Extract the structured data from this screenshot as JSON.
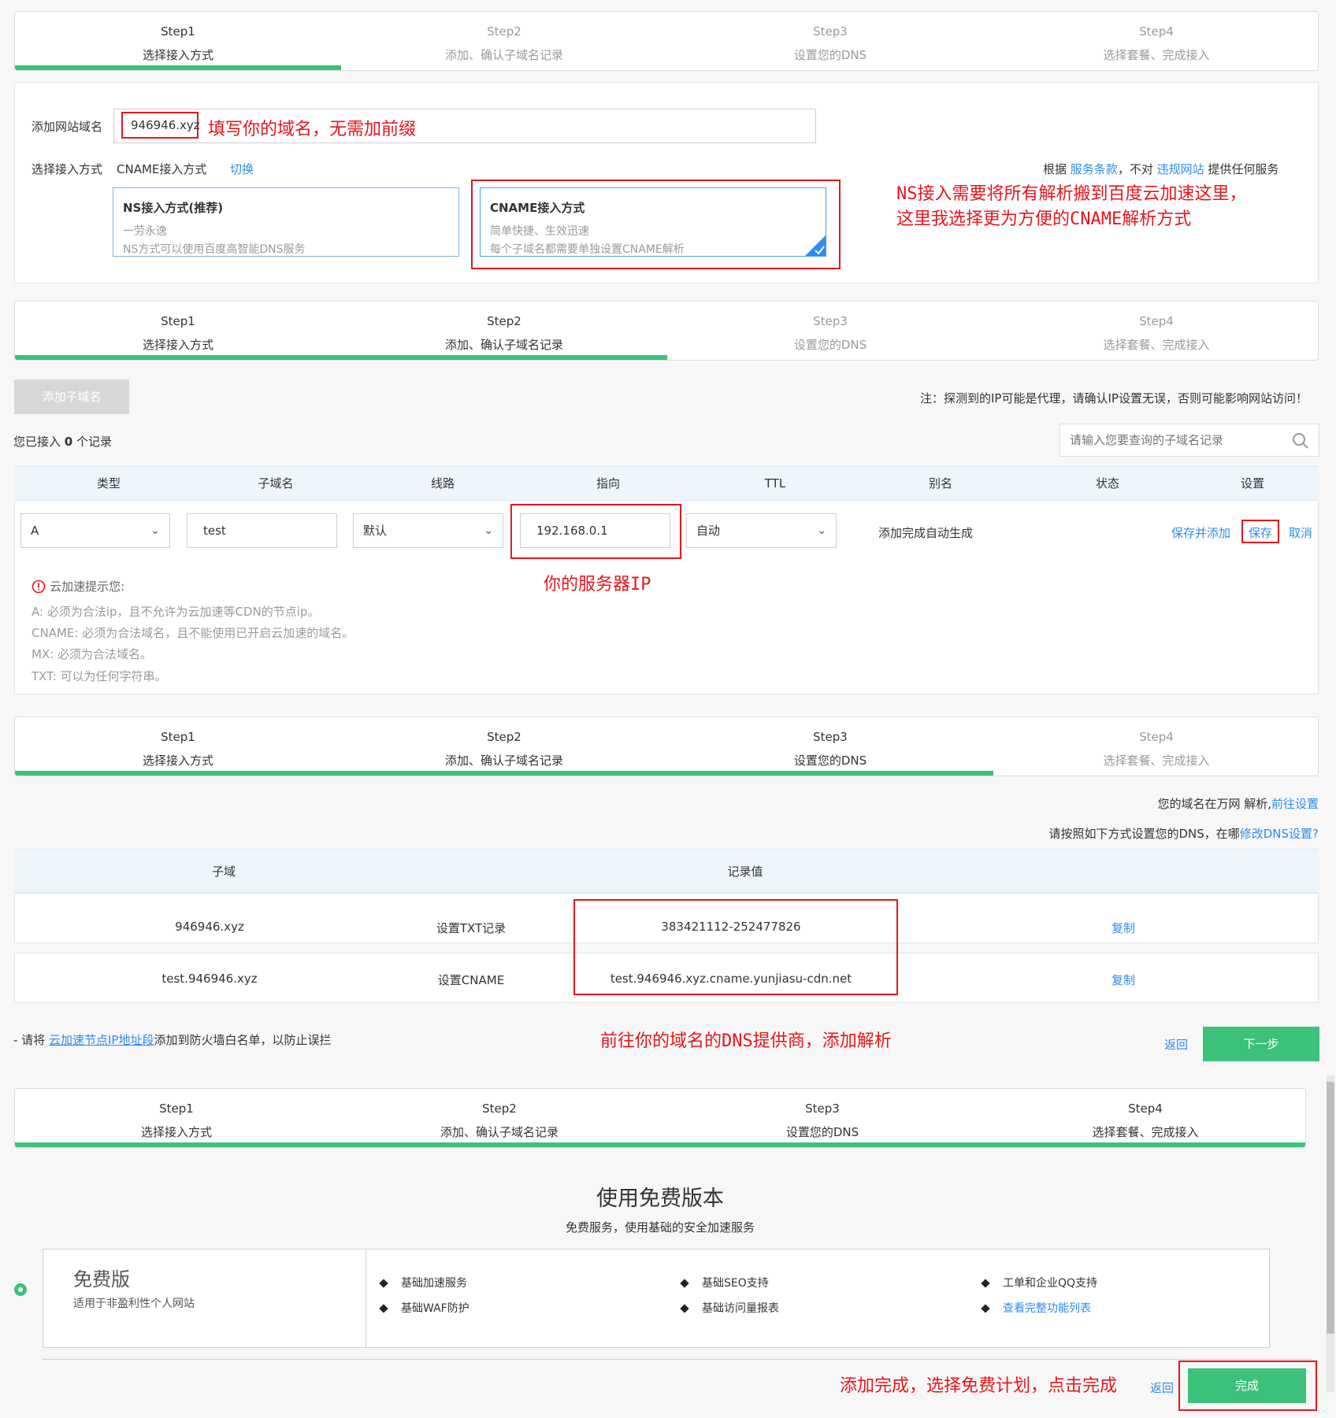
{
  "steps": [
    {
      "n": "Step1",
      "label": "选择接入方式"
    },
    {
      "n": "Step2",
      "label": "添加、确认子域名记录"
    },
    {
      "n": "Step3",
      "label": "设置您的DNS"
    },
    {
      "n": "Step4",
      "label": "选择套餐、完成接入"
    }
  ],
  "section1": {
    "domain_label": "添加网站域名",
    "domain_value": "946946.xyz",
    "domain_note": "填写你的域名，无需加前缀",
    "method_label": "选择接入方式",
    "method_value": "CNAME接入方式",
    "switch": "切换",
    "terms": {
      "pre": "根据",
      "terms_link": "服务条款",
      "mid": "，不对",
      "illegal_link": "违规网站",
      "post": "提供任何服务"
    },
    "ns_card": {
      "title": "NS接入方式(推荐)",
      "line1": "一劳永逸",
      "line2": "NS方式可以使用百度高智能DNS服务"
    },
    "cname_card": {
      "title": "CNAME接入方式",
      "line1": "简单快捷、生效迅速",
      "line2": "每个子域名都需要单独设置CNAME解析"
    },
    "note_line1": "NS接入需要将所有解析搬到百度云加速这里，",
    "note_line2": "这里我选择更为方便的CNAME解析方式"
  },
  "section2": {
    "add_sub": "添加子域名",
    "warning": "注：探测到的IP可能是代理，请确认IP设置无误，否则可能影响网站访问！",
    "count_pre": "您已接入",
    "count": "0",
    "count_post": "个记录",
    "search_placeholder": "请输入您要查询的子域名记录",
    "headers": [
      "类型",
      "子域名",
      "线路",
      "指向",
      "TTL",
      "别名",
      "状态",
      "设置"
    ],
    "row": {
      "type": "A",
      "sub": "test",
      "line": "默认",
      "target": "192.168.0.1",
      "ttl": "自动",
      "alias": "添加完成自动生成",
      "save_add": "保存并添加",
      "save": "保存",
      "cancel": "取消"
    },
    "ip_note": "你的服务器IP",
    "tips_title": "云加速提示您:",
    "tips": [
      "A:  必须为合法ip，且不允许为云加速等CDN的节点ip。",
      "CNAME:  必须为合法域名，且不能使用已开启云加速的域名。",
      "MX:  必须为合法域名。",
      "TXT:  可以为任何字符串。"
    ]
  },
  "section3": {
    "dns_pre": "您的域名在万网 解析,",
    "dns_link": "前往设置",
    "setup_pre": "请按照如下方式设置您的DNS，在哪",
    "setup_link": "修改DNS设置?",
    "headers": [
      "子域",
      "记录值"
    ],
    "rows": [
      {
        "sub": "946946.xyz",
        "op": "设置TXT记录",
        "value": "383421112-252477826",
        "copy": "复制"
      },
      {
        "sub": "test.946946.xyz",
        "op": "设置CNAME",
        "value": "test.946946.xyz.cname.yunjiasu-cdn.net",
        "copy": "复制"
      }
    ],
    "firewall_pre": "- 请将",
    "firewall_link": "云加速节点IP地址段",
    "firewall_post": "添加到防火墙白名单，以防止误拦",
    "note": "前往你的域名的DNS提供商，添加解析",
    "back": "返回",
    "next": "下一步"
  },
  "section4": {
    "title": "使用免费版本",
    "subtitle": "免费服务，使用基础的安全加速服务",
    "plan_name": "免费版",
    "plan_desc": "适用于非盈利性个人网站",
    "features": [
      "基础加速服务",
      "基础SEO支持",
      "工单和企业QQ支持",
      "基础WAF防护",
      "基础访问量报表",
      "查看完整功能列表"
    ],
    "note": "添加完成，选择免费计划，点击完成",
    "back": "返回",
    "finish": "完成"
  },
  "colors": {
    "green": "#3cc17a",
    "red": "#e8161a",
    "link": "#2d8cf0"
  }
}
